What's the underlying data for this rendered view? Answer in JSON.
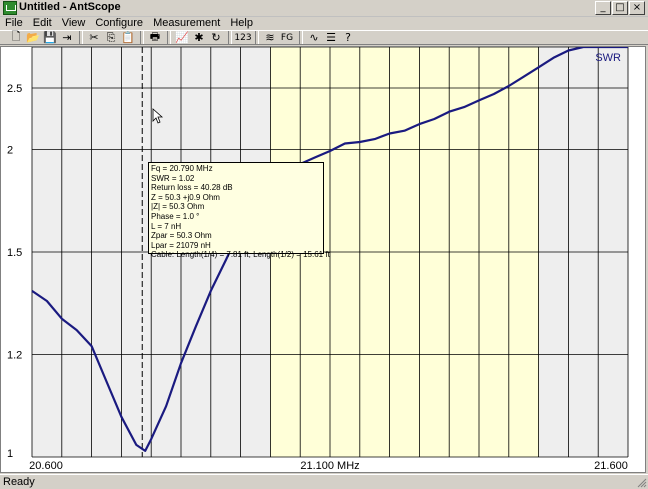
{
  "window": {
    "title": "Untitled - AntScope",
    "buttons": [
      "_",
      "□",
      "×"
    ]
  },
  "menu": [
    "File",
    "Edit",
    "View",
    "Configure",
    "Measurement",
    "Help"
  ],
  "toolbar": {
    "items": [
      {
        "icon": "new-icon",
        "glyph": "🗋"
      },
      {
        "icon": "open-icon",
        "glyph": "📂"
      },
      {
        "icon": "save-icon",
        "glyph": "💾"
      },
      {
        "icon": "export-icon",
        "glyph": "⇥"
      },
      {
        "icon": "cut-icon",
        "glyph": "✂"
      },
      {
        "icon": "copy-icon",
        "glyph": "⎘"
      },
      {
        "icon": "paste-icon",
        "glyph": "📋"
      },
      {
        "icon": "print-icon",
        "glyph": "🖶"
      },
      {
        "icon": "chart-icon",
        "glyph": "📈"
      },
      {
        "icon": "run-icon",
        "glyph": "✱"
      },
      {
        "icon": "refresh-icon",
        "glyph": "↻"
      },
      {
        "icon": "numbers-icon",
        "text": "123"
      },
      {
        "icon": "wireless-icon",
        "glyph": "≋"
      },
      {
        "icon": "fg-icon",
        "text": "FG"
      },
      {
        "icon": "curve-icon",
        "glyph": "∿"
      },
      {
        "icon": "list-icon",
        "glyph": "☰"
      },
      {
        "icon": "help-icon",
        "glyph": "?"
      }
    ]
  },
  "status": {
    "text": "Ready"
  },
  "tooltip": {
    "lines": [
      "Fq = 20.790 MHz",
      "SWR = 1.02",
      "Return loss = 40.28 dB",
      "Z = 50.3 +j0.9 Ohm",
      "|Z| = 50.3 Ohm",
      "Phase = 1.0 °",
      "L = 7 nH",
      "Zpar = 50.3 Ohm",
      "Lpar = 21079 nH",
      "Cable: Length(1/4) = 7.81 ft, Length(1/2) = 15.61 ft"
    ]
  },
  "chart_data": {
    "type": "line",
    "legend": "SWR",
    "legend_position": "top-right",
    "x_tick_labels": [
      "20.600",
      "21.100 MHz",
      "21.600"
    ],
    "y_tick_labels": [
      "2.5",
      "2",
      "1.5",
      "1.2",
      "1"
    ],
    "y_ticks": [
      1,
      1.2,
      1.5,
      2,
      2.5
    ],
    "xlim": [
      20.6,
      21.6
    ],
    "ylim": [
      1,
      3
    ],
    "cursor_x": 20.79,
    "highlight_band": [
      21.0,
      21.45
    ],
    "grid": true,
    "series": [
      {
        "name": "SWR",
        "color": "#1a1a80",
        "x": [
          20.6,
          20.625,
          20.65,
          20.675,
          20.7,
          20.725,
          20.75,
          20.775,
          20.79,
          20.8,
          20.825,
          20.85,
          20.875,
          20.9,
          20.925,
          20.95,
          20.975,
          21.0,
          21.025,
          21.05,
          21.075,
          21.1,
          21.125,
          21.15,
          21.175,
          21.2,
          21.225,
          21.25,
          21.275,
          21.3,
          21.325,
          21.35,
          21.375,
          21.4,
          21.425,
          21.45,
          21.475,
          21.5,
          21.525,
          21.55,
          21.575,
          21.6
        ],
        "y": [
          1.37,
          1.34,
          1.29,
          1.26,
          1.22,
          1.14,
          1.07,
          1.02,
          1.01,
          1.03,
          1.09,
          1.18,
          1.27,
          1.37,
          1.47,
          1.59,
          1.67,
          1.79,
          1.88,
          1.91,
          1.95,
          1.99,
          2.04,
          2.05,
          2.07,
          2.11,
          2.13,
          2.18,
          2.22,
          2.28,
          2.32,
          2.38,
          2.44,
          2.52,
          2.62,
          2.73,
          2.85,
          2.95,
          3.0,
          3.0,
          3.0,
          3.0
        ]
      }
    ]
  }
}
